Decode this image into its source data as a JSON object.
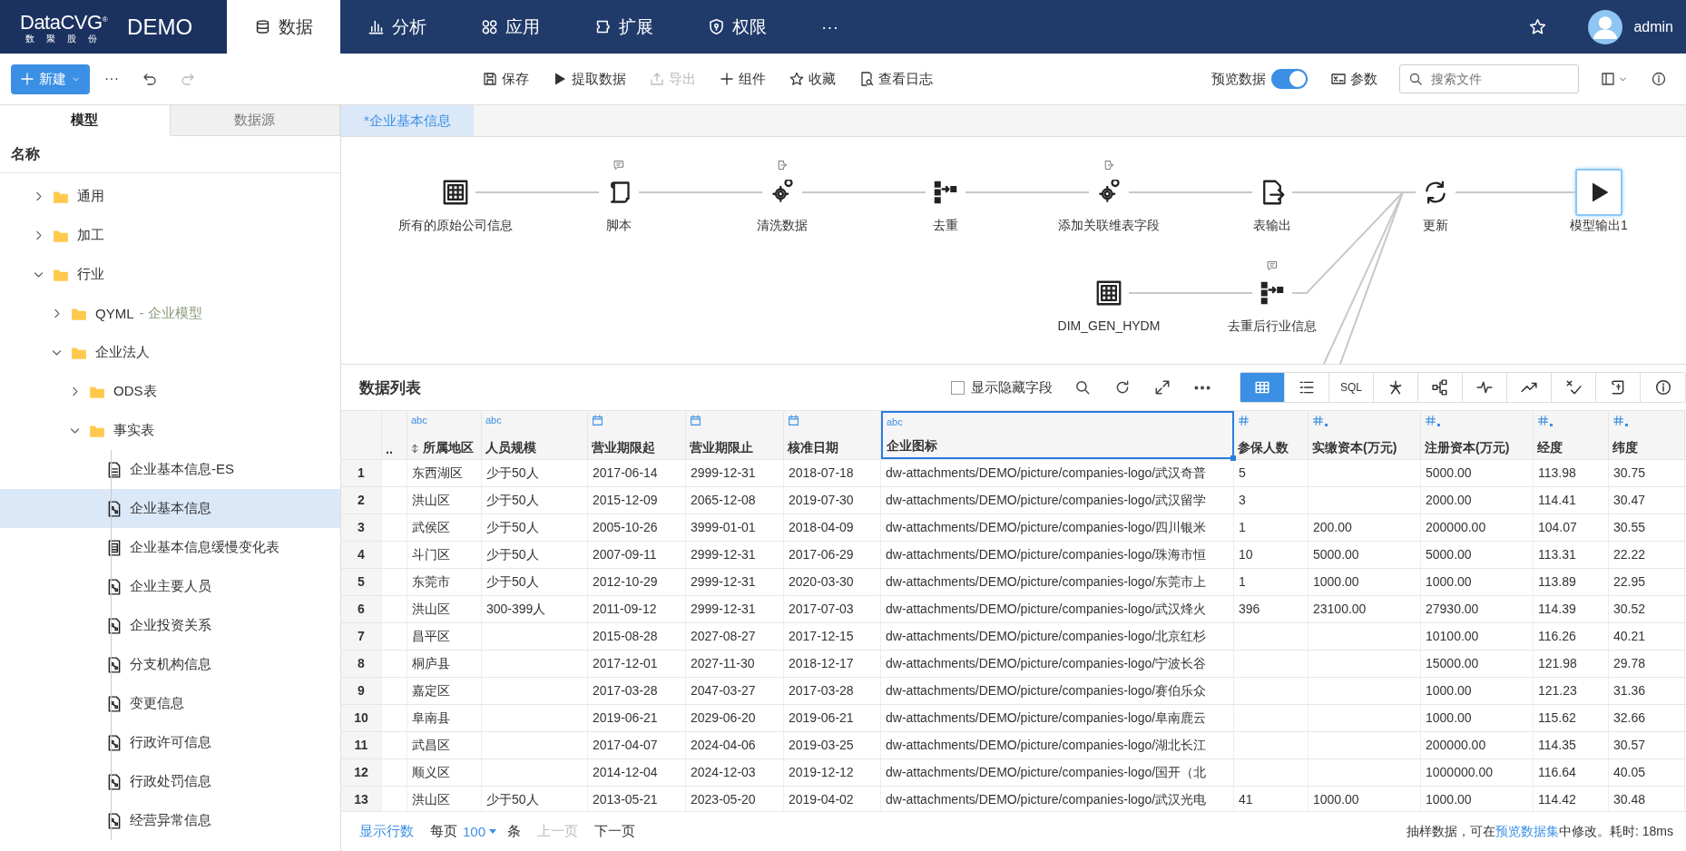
{
  "app": {
    "logo": "DataCVG",
    "logo_mark": "®",
    "logo_sub": "数 聚 股 份",
    "env": "DEMO"
  },
  "nav": [
    {
      "label": "数据",
      "kind": "data",
      "selected": true
    },
    {
      "label": "分析",
      "kind": "analysis",
      "selected": false
    },
    {
      "label": "应用",
      "kind": "apps",
      "selected": false
    },
    {
      "label": "扩展",
      "kind": "extensions",
      "selected": false
    },
    {
      "label": "权限",
      "kind": "permissions",
      "selected": false
    }
  ],
  "nav_more": "···",
  "user": {
    "name": "admin"
  },
  "toolbar": {
    "new_button": "新建",
    "more": "···",
    "history": [
      {
        "kind": "undo",
        "disabled": false
      },
      {
        "kind": "redo",
        "disabled": true
      }
    ],
    "actions": [
      {
        "label": "保存",
        "kind": "save",
        "disabled": false
      },
      {
        "label": "提取数据",
        "kind": "extract",
        "disabled": false
      },
      {
        "label": "导出",
        "kind": "export",
        "disabled": true
      },
      {
        "label": "组件",
        "kind": "component",
        "disabled": false
      },
      {
        "label": "收藏",
        "kind": "favorite",
        "disabled": false
      },
      {
        "label": "查看日志",
        "kind": "log",
        "disabled": false
      }
    ],
    "preview": {
      "label": "预览数据",
      "on": true
    },
    "params": "参数",
    "search": {
      "placeholder": "搜索文件"
    }
  },
  "left_tabs": [
    {
      "label": "模型",
      "selected": true
    },
    {
      "label": "数据源",
      "selected": false
    }
  ],
  "tree_header": "名称",
  "tree": [
    {
      "label": "通用",
      "kind": "folder",
      "expanded": false,
      "selected": false
    },
    {
      "label": "加工",
      "kind": "folder",
      "expanded": false,
      "selected": false
    },
    {
      "label": "行业",
      "kind": "folder",
      "expanded": true,
      "selected": false,
      "children": [
        {
          "label": "QYML",
          "note": "- 企业模型",
          "kind": "folder",
          "expanded": false,
          "selected": false
        },
        {
          "label": "企业法人",
          "kind": "folder",
          "expanded": true,
          "selected": false,
          "children": [
            {
              "label": "ODS表",
              "kind": "folder",
              "expanded": false,
              "selected": false
            },
            {
              "label": "事实表",
              "kind": "folder",
              "expanded": true,
              "selected": false,
              "children": [
                {
                  "label": "企业基本信息-ES",
                  "kind": "list",
                  "selected": false
                },
                {
                  "label": "企业基本信息",
                  "kind": "flow",
                  "selected": true
                },
                {
                  "label": "企业基本信息缓慢变化表",
                  "kind": "table",
                  "selected": false
                },
                {
                  "label": "企业主要人员",
                  "kind": "flow",
                  "selected": false
                },
                {
                  "label": "企业投资关系",
                  "kind": "flow",
                  "selected": false
                },
                {
                  "label": "分支机构信息",
                  "kind": "flow",
                  "selected": false
                },
                {
                  "label": "变更信息",
                  "kind": "flow",
                  "selected": false
                },
                {
                  "label": "行政许可信息",
                  "kind": "flow",
                  "selected": false
                },
                {
                  "label": "行政处罚信息",
                  "kind": "flow",
                  "selected": false
                },
                {
                  "label": "经营异常信息",
                  "kind": "flow",
                  "selected": false
                }
              ]
            }
          ]
        }
      ]
    }
  ],
  "editor_tabs": [
    {
      "label": "*企业基本信息",
      "selected": true
    }
  ],
  "flow": {
    "main": [
      {
        "label": "所有的原始公司信息",
        "kind": "table",
        "selected": false
      },
      {
        "label": "脚本",
        "kind": "script",
        "badge": {
          "kind": "comment"
        },
        "selected": false
      },
      {
        "label": "清洗数据",
        "kind": "clean",
        "badge": {
          "kind": "export"
        },
        "selected": false
      },
      {
        "label": "去重",
        "kind": "dedupe",
        "selected": false
      },
      {
        "label": "添加关联维表字段",
        "kind": "clean",
        "badge": {
          "kind": "export"
        },
        "selected": false
      },
      {
        "label": "表输出",
        "kind": "output",
        "selected": false
      },
      {
        "label": "更新",
        "kind": "update",
        "selected": false
      },
      {
        "label": "模型输出1",
        "kind": "model",
        "selected": true
      }
    ],
    "branch": [
      {
        "label": "DIM_GEN_HYDM",
        "kind": "table",
        "selected": false
      },
      {
        "label": "去重后行业信息",
        "kind": "dedupe",
        "badge": {
          "kind": "comment"
        },
        "selected": false
      }
    ]
  },
  "data_panel": {
    "title": "数据列表",
    "show_hidden": {
      "label": "显示隐藏字段",
      "checked": false
    },
    "tools": [
      {
        "kind": "search"
      },
      {
        "kind": "refresh"
      },
      {
        "kind": "expand"
      },
      {
        "kind": "more"
      }
    ],
    "views": [
      {
        "kind": "grid",
        "selected": true
      },
      {
        "kind": "list",
        "selected": false
      },
      {
        "kind": "sql",
        "label": "SQL",
        "selected": false
      },
      {
        "kind": "graph",
        "selected": false
      },
      {
        "kind": "tree",
        "selected": false
      },
      {
        "kind": "pulse",
        "selected": false
      },
      {
        "kind": "trend",
        "selected": false
      },
      {
        "kind": "check",
        "selected": false
      },
      {
        "kind": "script",
        "selected": false
      },
      {
        "kind": "info",
        "selected": false
      }
    ]
  },
  "table": {
    "columns": [
      {
        "label": "..",
        "kind": "plain",
        "sorted": false,
        "selected": false
      },
      {
        "label": "所属地区",
        "kind": "text",
        "type_label": "abc",
        "sorted": true,
        "selected": false
      },
      {
        "label": "人员规模",
        "kind": "text",
        "type_label": "abc",
        "sorted": false,
        "selected": false
      },
      {
        "label": "营业期限起",
        "kind": "date",
        "sorted": false,
        "selected": false
      },
      {
        "label": "营业期限止",
        "kind": "date",
        "sorted": false,
        "selected": false
      },
      {
        "label": "核准日期",
        "kind": "date",
        "sorted": false,
        "selected": false
      },
      {
        "label": "企业图标",
        "kind": "text",
        "type_label": "abc",
        "sorted": false,
        "selected": true
      },
      {
        "label": "参保人数",
        "kind": "integer",
        "sorted": false,
        "selected": false
      },
      {
        "label": "实缴资本(万元)",
        "kind": "decimal",
        "sorted": false,
        "selected": false
      },
      {
        "label": "注册资本(万元)",
        "kind": "decimal",
        "sorted": false,
        "selected": false
      },
      {
        "label": "经度",
        "kind": "decimal",
        "sorted": false,
        "selected": false
      },
      {
        "label": "纬度",
        "kind": "decimal",
        "sorted": false,
        "selected": false
      }
    ],
    "rows": [
      {
        "n": "1",
        "cells": [
          null,
          "东西湖区",
          "少于50人",
          "2017-06-14",
          "2999-12-31",
          "2018-07-18",
          "dw-attachments/DEMO/picture/companies-logo/武汉奇普",
          "5",
          null,
          "5000.00",
          "113.98",
          "30.75"
        ]
      },
      {
        "n": "2",
        "cells": [
          null,
          "洪山区",
          "少于50人",
          "2015-12-09",
          "2065-12-08",
          "2019-07-30",
          "dw-attachments/DEMO/picture/companies-logo/武汉留学",
          "3",
          null,
          "2000.00",
          "114.41",
          "30.47"
        ]
      },
      {
        "n": "3",
        "cells": [
          null,
          "武侯区",
          "少于50人",
          "2005-10-26",
          "3999-01-01",
          "2018-04-09",
          "dw-attachments/DEMO/picture/companies-logo/四川银米",
          "1",
          "200.00",
          "200000.00",
          "104.07",
          "30.55"
        ]
      },
      {
        "n": "4",
        "cells": [
          null,
          "斗门区",
          "少于50人",
          "2007-09-11",
          "2999-12-31",
          "2017-06-29",
          "dw-attachments/DEMO/picture/companies-logo/珠海市恒",
          "10",
          "5000.00",
          "5000.00",
          "113.31",
          "22.22"
        ]
      },
      {
        "n": "5",
        "cells": [
          null,
          "东莞市",
          "少于50人",
          "2012-10-29",
          "2999-12-31",
          "2020-03-30",
          "dw-attachments/DEMO/picture/companies-logo/东莞市上",
          "1",
          "1000.00",
          "1000.00",
          "113.89",
          "22.95"
        ]
      },
      {
        "n": "6",
        "cells": [
          null,
          "洪山区",
          "300-399人",
          "2011-09-12",
          "2999-12-31",
          "2017-07-03",
          "dw-attachments/DEMO/picture/companies-logo/武汉烽火",
          "396",
          "23100.00",
          "27930.00",
          "114.39",
          "30.52"
        ]
      },
      {
        "n": "7",
        "cells": [
          null,
          "昌平区",
          null,
          "2015-08-28",
          "2027-08-27",
          "2017-12-15",
          "dw-attachments/DEMO/picture/companies-logo/北京红杉",
          null,
          null,
          "10100.00",
          "116.26",
          "40.21"
        ]
      },
      {
        "n": "8",
        "cells": [
          null,
          "桐庐县",
          null,
          "2017-12-01",
          "2027-11-30",
          "2018-12-17",
          "dw-attachments/DEMO/picture/companies-logo/宁波长谷",
          null,
          null,
          "15000.00",
          "121.98",
          "29.78"
        ]
      },
      {
        "n": "9",
        "cells": [
          null,
          "嘉定区",
          null,
          "2017-03-28",
          "2047-03-27",
          "2017-03-28",
          "dw-attachments/DEMO/picture/companies-logo/赛伯乐众",
          null,
          null,
          "1000.00",
          "121.23",
          "31.36"
        ]
      },
      {
        "n": "10",
        "cells": [
          null,
          "阜南县",
          null,
          "2019-06-21",
          "2029-06-20",
          "2019-06-21",
          "dw-attachments/DEMO/picture/companies-logo/阜南鹿云",
          null,
          null,
          "1000.00",
          "115.62",
          "32.66"
        ]
      },
      {
        "n": "11",
        "cells": [
          null,
          "武昌区",
          null,
          "2017-04-07",
          "2024-04-06",
          "2019-03-25",
          "dw-attachments/DEMO/picture/companies-logo/湖北长江",
          null,
          null,
          "200000.00",
          "114.35",
          "30.57"
        ]
      },
      {
        "n": "12",
        "cells": [
          null,
          "顺义区",
          null,
          "2014-12-04",
          "2024-12-03",
          "2019-12-12",
          "dw-attachments/DEMO/picture/companies-logo/国开（北",
          null,
          null,
          "1000000.00",
          "116.64",
          "40.05"
        ]
      },
      {
        "n": "13",
        "cells": [
          null,
          "洪山区",
          "少于50人",
          "2013-05-21",
          "2023-05-20",
          "2019-04-02",
          "dw-attachments/DEMO/picture/companies-logo/武汉光电",
          "41",
          "1000.00",
          "1000.00",
          "114.42",
          "30.48"
        ]
      }
    ]
  },
  "footer": {
    "rows_link": "显示行数",
    "per_page": "每页",
    "page_size": "100",
    "unit": "条",
    "prev": {
      "label": "上一页",
      "disabled": true
    },
    "next": {
      "label": "下一页",
      "disabled": false
    },
    "status": {
      "before": "抽样数据，可在",
      "link": "预览数据集",
      "after": "中修改。耗时: 18ms"
    }
  }
}
